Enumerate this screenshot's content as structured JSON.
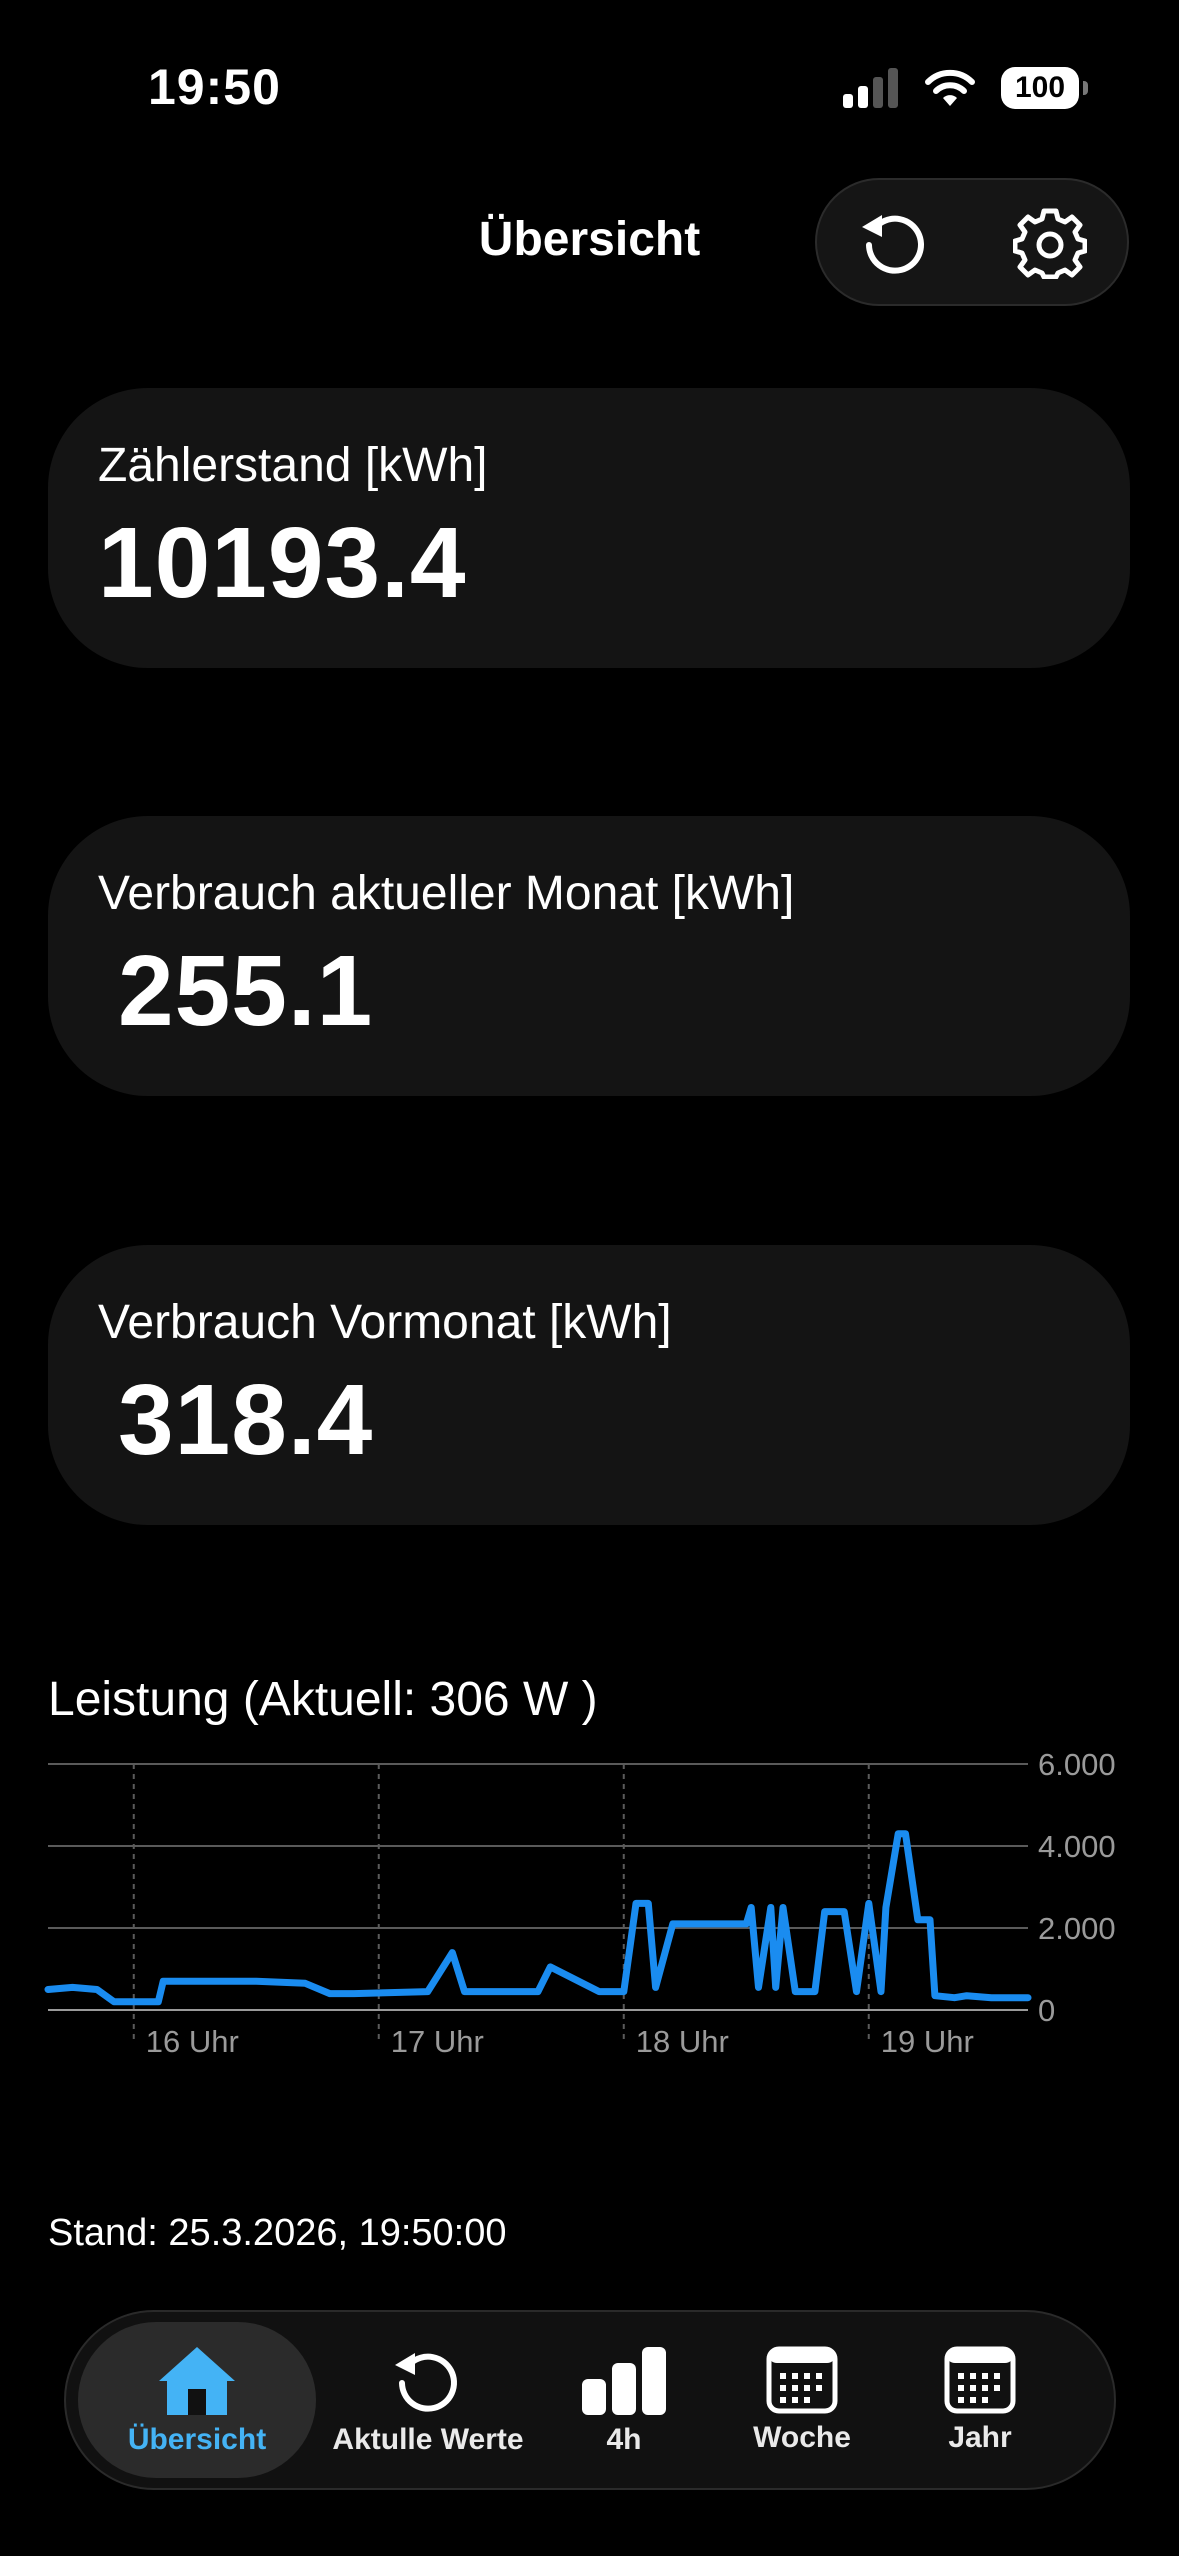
{
  "status_bar": {
    "time": "19:50",
    "battery": "100"
  },
  "header": {
    "title": "Übersicht",
    "refresh_icon": "refresh-icon",
    "settings_icon": "gear-icon"
  },
  "cards": [
    {
      "label": "Zählerstand [kWh]",
      "value": "10193.4"
    },
    {
      "label": "Verbrauch aktueller Monat [kWh]",
      "value": "255.1"
    },
    {
      "label": "Verbrauch Vormonat [kWh]",
      "value": "318.4"
    }
  ],
  "chart_title": "Leistung (Aktuell:  306 W )",
  "chart_data": {
    "type": "line",
    "title": "Leistung (Aktuell:  306 W )",
    "xlabel": "",
    "ylabel": "",
    "x_ticks": [
      "16 Uhr",
      "17 Uhr",
      "18 Uhr",
      "19 Uhr"
    ],
    "y_ticks": [
      "6.000",
      "4.000",
      "2.000",
      "0"
    ],
    "ylim": [
      0,
      6000
    ],
    "xlim": [
      15.65,
      19.65
    ],
    "grid": true,
    "color": "#1a8cf0",
    "series": [
      {
        "x": [
          15.65,
          15.75,
          15.85,
          15.92,
          16.1,
          16.12,
          16.5,
          16.7,
          16.8,
          16.9,
          17.2,
          17.3,
          17.35,
          17.5,
          17.65,
          17.7,
          17.9,
          18.0,
          18.05,
          18.1,
          18.13,
          18.2,
          18.3,
          18.5,
          18.52,
          18.55,
          18.6,
          18.62,
          18.65,
          18.7,
          18.78,
          18.82,
          18.9,
          18.95,
          19.0,
          19.05,
          19.07,
          19.12,
          19.15,
          19.2,
          19.25,
          19.27,
          19.35,
          19.4,
          19.5,
          19.65
        ],
        "y": [
          500,
          550,
          500,
          200,
          200,
          700,
          700,
          650,
          400,
          400,
          450,
          1400,
          450,
          450,
          450,
          1050,
          450,
          450,
          2600,
          2600,
          550,
          2100,
          2100,
          2100,
          2500,
          550,
          2500,
          550,
          2500,
          450,
          450,
          2400,
          2400,
          450,
          2600,
          450,
          2500,
          4300,
          4300,
          2200,
          2200,
          350,
          300,
          350,
          300,
          300
        ]
      }
    ]
  },
  "stand_text": "Stand: 25.3.2026, 19:50:00",
  "tabs": [
    {
      "label": "Übersicht",
      "icon": "house-icon",
      "active": true
    },
    {
      "label": "Aktulle Werte",
      "icon": "refresh-icon"
    },
    {
      "label": "4h",
      "icon": "bar-chart-icon"
    },
    {
      "label": "Woche",
      "icon": "calendar-icon"
    },
    {
      "label": "Jahr",
      "icon": "calendar-icon"
    }
  ],
  "colors": {
    "accent": "#44b3f5",
    "line": "#1a8cf0",
    "card_bg": "#141414",
    "background": "#000000"
  }
}
